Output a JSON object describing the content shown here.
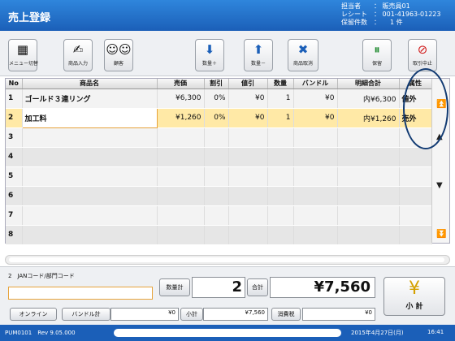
{
  "header": {
    "title": "売上登録",
    "info": [
      {
        "key": "担当者",
        "value": "： 販売員01"
      },
      {
        "key": "レシート",
        "value": "： 001-41963-01223"
      },
      {
        "key": "保留件数",
        "value": "：　　1 件"
      }
    ]
  },
  "toolbar": {
    "buttons": [
      {
        "label": "メニュー切替",
        "icon": "menu-grid-icon"
      },
      {
        "label": "商品入力",
        "icon": "hand-icon"
      },
      {
        "label": "顧客",
        "icon": "customers-icon"
      },
      {
        "label": "数量＋",
        "icon": "cart-plus-icon"
      },
      {
        "label": "数量－",
        "icon": "cart-minus-icon"
      },
      {
        "label": "商品取消",
        "icon": "cart-cancel-icon"
      },
      {
        "label": "保留",
        "icon": "pause-icon"
      },
      {
        "label": "取引中止",
        "icon": "stop-icon"
      }
    ]
  },
  "table": {
    "columns": [
      "No",
      "商品名",
      "売価",
      "割引",
      "値引",
      "数量",
      "バンドル",
      "明細合計",
      "属性"
    ],
    "rows": [
      {
        "no": "1",
        "name": "ゴールド３連リング",
        "price": "¥6,300",
        "disc": "0%",
        "nebiki": "¥0",
        "qty": "1",
        "bundle": "¥0",
        "total": "内¥6,300",
        "attr": "値外"
      },
      {
        "no": "2",
        "name": "加工料",
        "price": "¥1,260",
        "disc": "0%",
        "nebiki": "¥0",
        "qty": "1",
        "bundle": "¥0",
        "total": "内¥1,260",
        "attr": "売外"
      },
      {
        "no": "3",
        "name": "",
        "price": "",
        "disc": "",
        "nebiki": "",
        "qty": "",
        "bundle": "",
        "total": "",
        "attr": ""
      },
      {
        "no": "4",
        "name": "",
        "price": "",
        "disc": "",
        "nebiki": "",
        "qty": "",
        "bundle": "",
        "total": "",
        "attr": ""
      },
      {
        "no": "5",
        "name": "",
        "price": "",
        "disc": "",
        "nebiki": "",
        "qty": "",
        "bundle": "",
        "total": "",
        "attr": ""
      },
      {
        "no": "6",
        "name": "",
        "price": "",
        "disc": "",
        "nebiki": "",
        "qty": "",
        "bundle": "",
        "total": "",
        "attr": ""
      },
      {
        "no": "7",
        "name": "",
        "price": "",
        "disc": "",
        "nebiki": "",
        "qty": "",
        "bundle": "",
        "total": "",
        "attr": ""
      },
      {
        "no": "8",
        "name": "",
        "price": "",
        "disc": "",
        "nebiki": "",
        "qty": "",
        "bundle": "",
        "total": "",
        "attr": ""
      }
    ]
  },
  "bottom": {
    "jan_label": "2　JANコード/部門コード",
    "jan_value": "",
    "qty_label": "数量計",
    "qty_value": "2",
    "total_label": "合計",
    "total_value": "¥7,560",
    "online_label": "オンライン",
    "bundle_label": "バンドル計",
    "bundle_value": "¥0",
    "subtotal_label": "小計",
    "subtotal_value": "¥7,560",
    "tax_label": "消費税",
    "tax_value": "¥0",
    "yen_label": "小 計"
  },
  "status": {
    "left": "PUM0101　Rev 9.05.000",
    "date": "2015年4月27日(月)",
    "time": "16:41"
  }
}
